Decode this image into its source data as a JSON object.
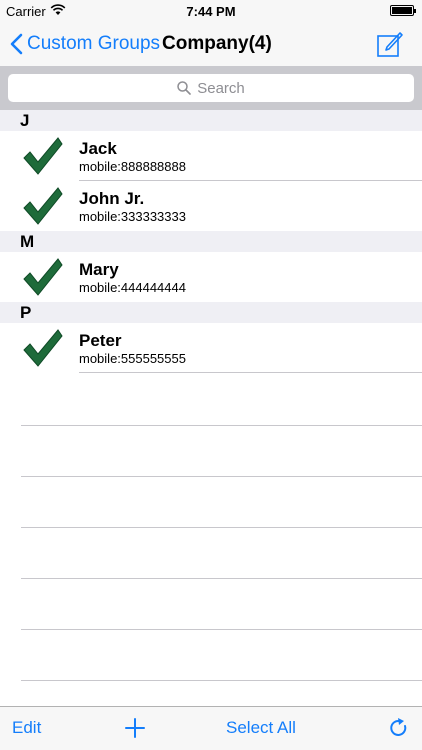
{
  "status_bar": {
    "carrier": "Carrier",
    "time": "7:44 PM"
  },
  "nav": {
    "back_label": "Custom Groups",
    "title": "Company(4)",
    "compose_icon": "compose-icon"
  },
  "search": {
    "placeholder": "Search"
  },
  "sections": [
    {
      "letter": "J",
      "contacts": [
        {
          "name": "Jack",
          "phone": "mobile:888888888",
          "checked": true
        },
        {
          "name": "John Jr.",
          "phone": "mobile:333333333",
          "checked": true
        }
      ]
    },
    {
      "letter": "M",
      "contacts": [
        {
          "name": "Mary",
          "phone": "mobile:444444444",
          "checked": true
        }
      ]
    },
    {
      "letter": "P",
      "contacts": [
        {
          "name": "Peter",
          "phone": "mobile:555555555",
          "checked": true
        }
      ]
    }
  ],
  "toolbar": {
    "edit_label": "Edit",
    "select_all_label": "Select All",
    "add_icon": "plus-icon",
    "refresh_icon": "refresh-icon"
  },
  "colors": {
    "accent": "#147efb",
    "check": "#1e6b3a"
  }
}
